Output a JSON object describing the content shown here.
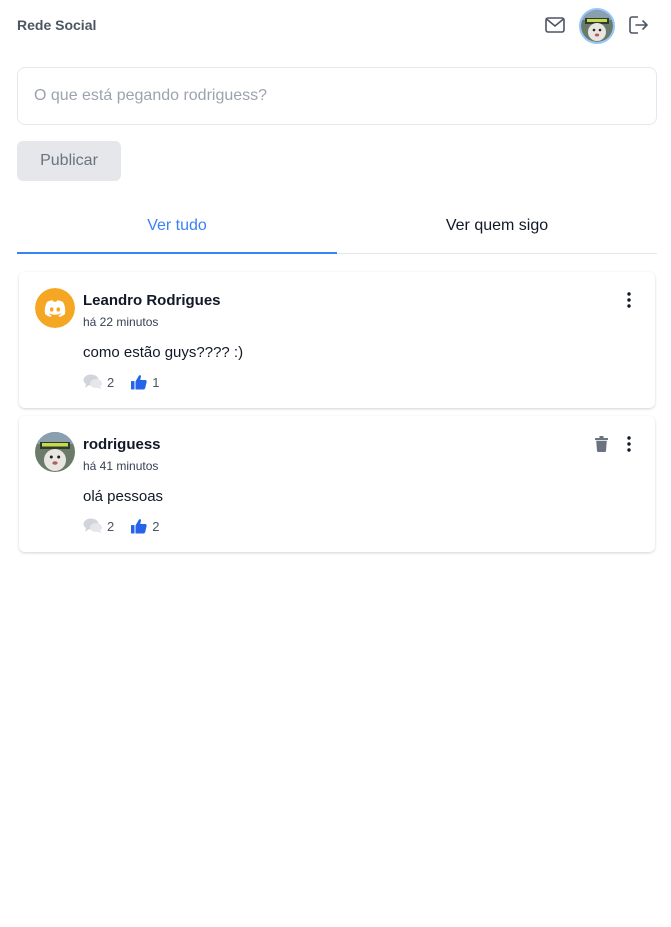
{
  "header": {
    "brand": "Rede Social",
    "icons": {
      "mail": "mail-icon",
      "avatar": "avatar",
      "logout": "logout-icon"
    }
  },
  "composer": {
    "placeholder": "O que está pegando rodriguess?",
    "value": "",
    "publish_label": "Publicar"
  },
  "tabs": [
    {
      "label": "Ver tudo",
      "active": true
    },
    {
      "label": "Ver quem sigo",
      "active": false
    }
  ],
  "posts": [
    {
      "author": "Leandro Rodrigues",
      "time": "há 22 minutos",
      "body": "como estão guys???? :)",
      "comments": "2",
      "likes": "1",
      "avatar_icon": "discord-icon",
      "can_delete": false
    },
    {
      "author": "rodriguess",
      "time": "há 41 minutos",
      "body": "olá pessoas",
      "comments": "2",
      "likes": "2",
      "avatar_icon": "user-photo",
      "can_delete": true
    }
  ],
  "colors": {
    "accent": "#3b82f6",
    "like": "#2563eb",
    "discord_bg": "#f5a623",
    "border": "#e5e7eb",
    "muted": "#9ca3af"
  }
}
